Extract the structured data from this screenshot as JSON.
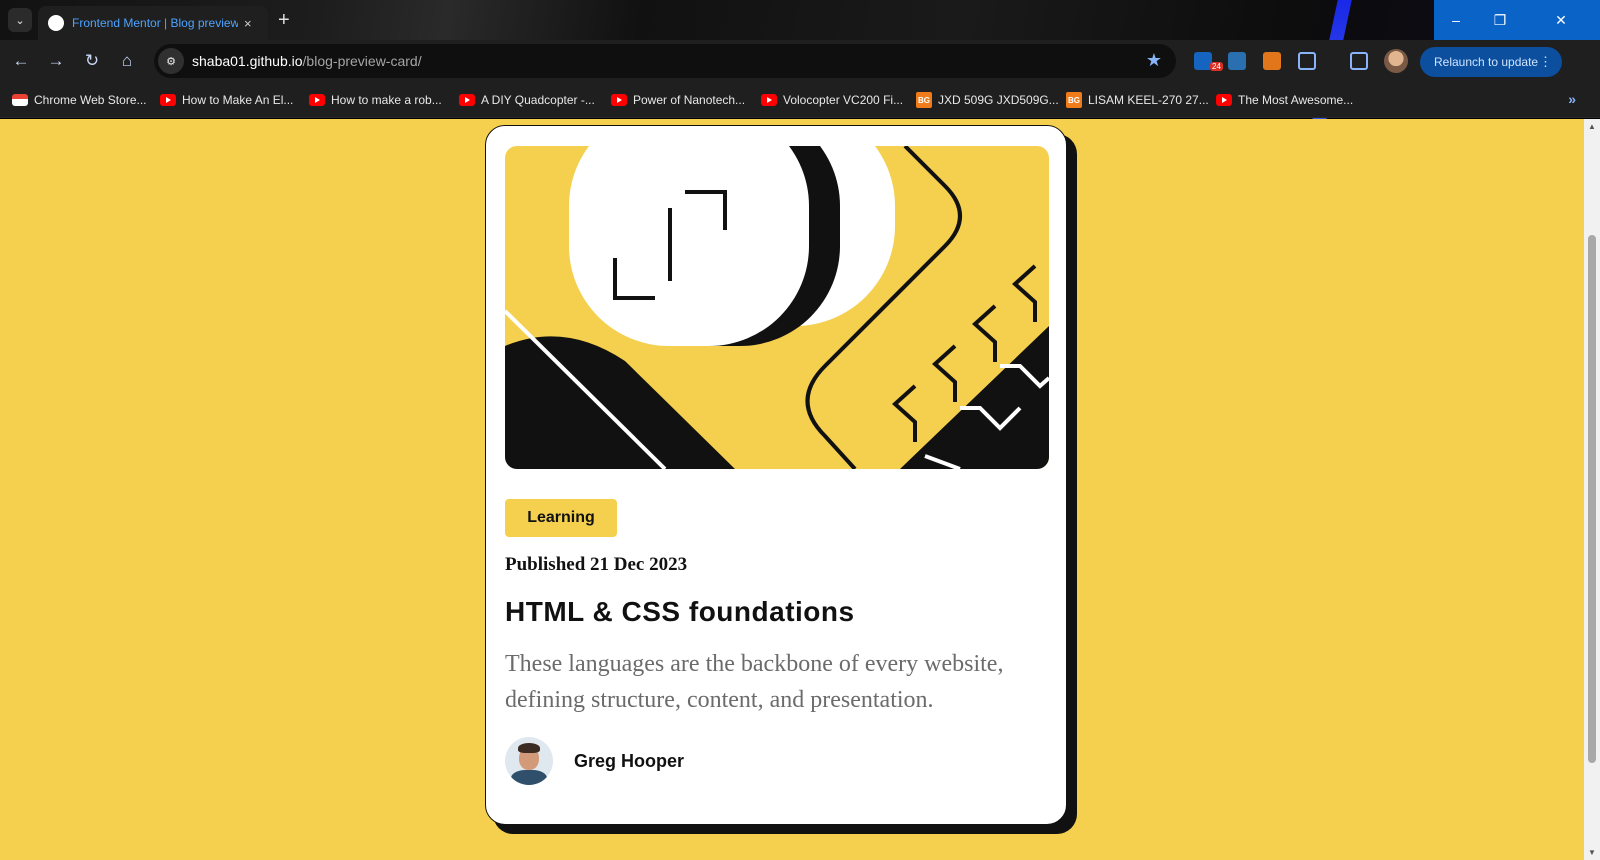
{
  "browser": {
    "tab_title": "Frontend Mentor | Blog preview card",
    "tab_close": "×",
    "new_tab": "+",
    "url_host": "shaba01.github.io",
    "url_path": "/blog-preview-card/",
    "relaunch_label": "Relaunch to update",
    "ext_badge": "24",
    "window_controls": {
      "minimize": "–",
      "restore": "❐",
      "close": "✕"
    },
    "bookmarks": [
      {
        "label": "Chrome Web Store...",
        "icon": "chrome-web-store-icon"
      },
      {
        "label": "How to Make An El...",
        "icon": "youtube-icon"
      },
      {
        "label": "How to make a rob...",
        "icon": "youtube-icon"
      },
      {
        "label": "A DIY Quadcopter -...",
        "icon": "youtube-icon"
      },
      {
        "label": "Power of Nanotech...",
        "icon": "youtube-icon"
      },
      {
        "label": "Volocopter VC200 Fi...",
        "icon": "youtube-icon"
      },
      {
        "label": "JXD 509G JXD509G...",
        "icon": "banggood-icon"
      },
      {
        "label": "LISAM KEEL-270 27...",
        "icon": "banggood-icon"
      },
      {
        "label": "The Most Awesome...",
        "icon": "youtube-icon"
      }
    ],
    "bookmarks_more": "»"
  },
  "card": {
    "tag": "Learning",
    "published": "Published 21 Dec 2023",
    "title": "HTML & CSS foundations",
    "description": "These languages are the backbone of every website, defining structure, content, and presentation.",
    "author": "Greg Hooper"
  },
  "colors": {
    "page_background": "#f4d04e",
    "card_background": "#ffffff",
    "ink": "#111111",
    "description_text": "#6b6b6b"
  }
}
